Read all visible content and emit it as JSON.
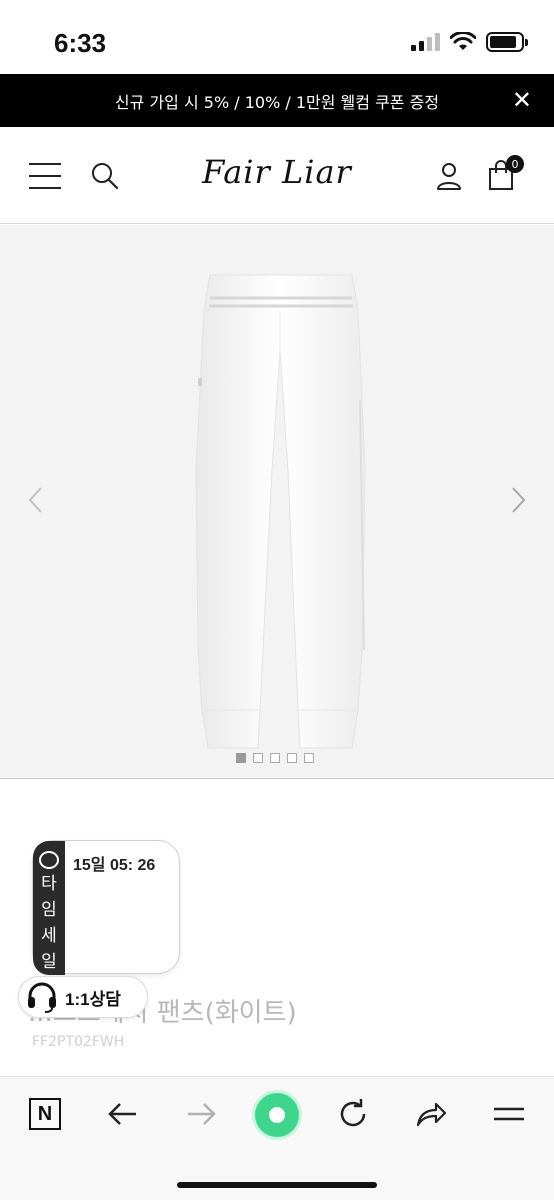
{
  "status_bar": {
    "time": "6:33"
  },
  "promo_banner": {
    "text": "신규 가입 시 5% / 10% / 1만원 웰컴 쿠폰 증정",
    "close": "✕"
  },
  "header": {
    "logo": "Fair Liar",
    "cart_count": "0"
  },
  "gallery": {
    "slide_count": 5,
    "active_slide": 1
  },
  "timesale": {
    "tab_chars": [
      "타",
      "임",
      "세",
      "일"
    ],
    "timer": "15일 05: 26"
  },
  "product": {
    "name": "...스트레치 팬츠(화이트)",
    "code": "FF2PT02FWH"
  },
  "chat": {
    "label": "1:1상담"
  },
  "colors": {
    "promo_bg": "#000000",
    "timesale_tab": "#2b2b2b",
    "browser_accent": "#3dd68c"
  }
}
